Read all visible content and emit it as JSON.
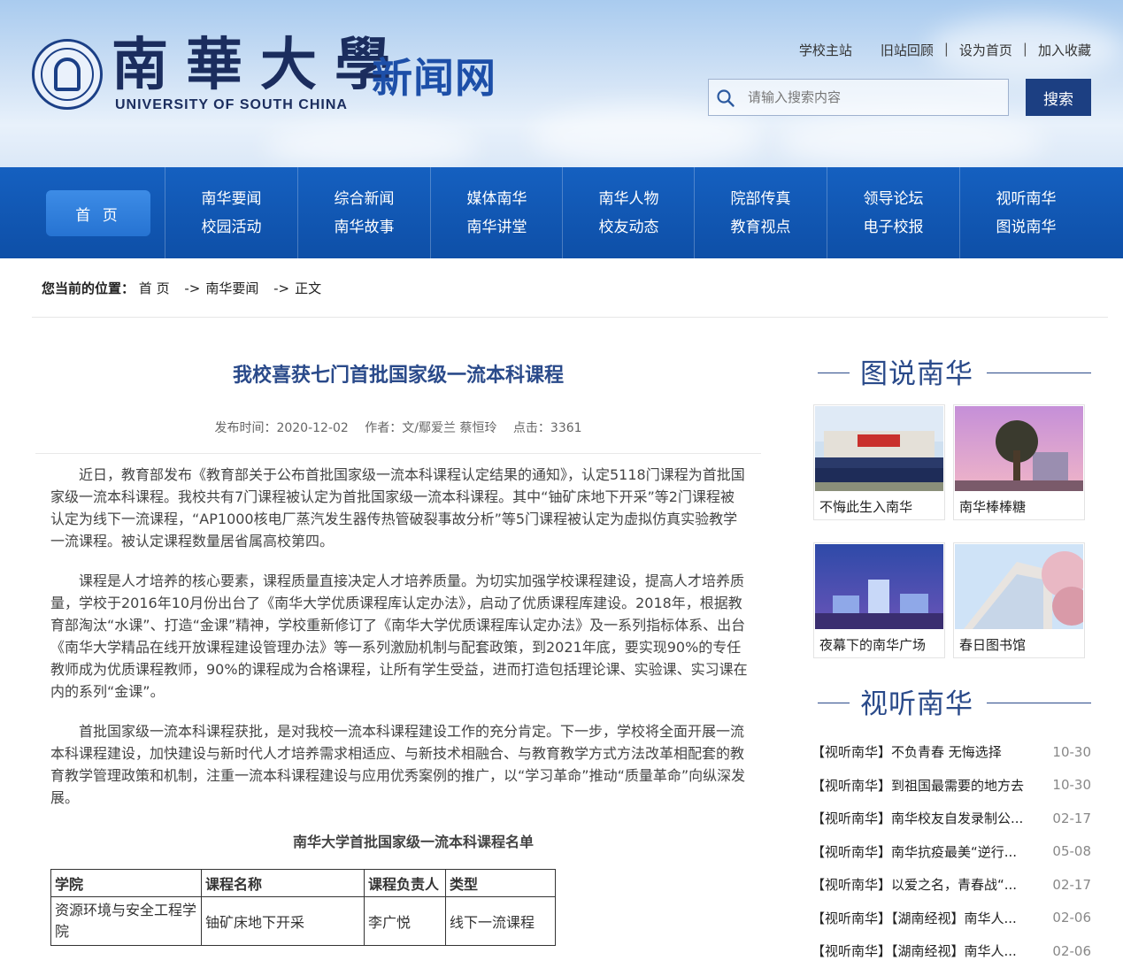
{
  "header": {
    "logo_cn": "南華大學",
    "logo_en": "UNIVERSITY OF SOUTH CHINA",
    "site_name": "新闻网",
    "top_links": [
      "学校主站",
      "旧站回顾",
      "设为首页",
      "加入收藏"
    ],
    "search_placeholder": "请输入搜索内容",
    "search_button": "搜索"
  },
  "nav": {
    "home": "首 页",
    "columns": [
      [
        "南华要闻",
        "校园活动"
      ],
      [
        "综合新闻",
        "南华故事"
      ],
      [
        "媒体南华",
        "南华讲堂"
      ],
      [
        "南华人物",
        "校友动态"
      ],
      [
        "院部传真",
        "教育视点"
      ],
      [
        "领导论坛",
        "电子校报"
      ],
      [
        "视听南华",
        "图说南华"
      ]
    ]
  },
  "breadcrumb": {
    "label": "您当前的位置：",
    "items": [
      "首 页",
      "南华要闻",
      "正文"
    ],
    "arrow": "->"
  },
  "article": {
    "title": "我校喜获七门首批国家级一流本科课程",
    "publish_time": "发布时间：2020-12-02",
    "author": "作者：文/鄢爱兰 蔡恒玲",
    "clicks": "点击：3361",
    "paragraphs": [
      "近日，教育部发布《教育部关于公布首批国家级一流本科课程认定结果的通知》，认定5118门课程为首批国家级一流本科课程。我校共有7门课程被认定为首批国家级一流本科课程。其中“铀矿床地下开采”等2门课程被认定为线下一流课程，“AP1000核电厂蒸汽发生器传热管破裂事故分析”等5门课程被认定为虚拟仿真实验教学一流课程。被认定课程数量居省属高校第四。",
      "课程是人才培养的核心要素，课程质量直接决定人才培养质量。为切实加强学校课程建设，提高人才培养质量，学校于2016年10月份出台了《南华大学优质课程库认定办法》，启动了优质课程库建设。2018年，根据教育部淘汰“水课”、打造“金课”精神，学校重新修订了《南华大学优质课程库认定办法》及一系列指标体系、出台《南华大学精品在线开放课程建设管理办法》等一系列激励机制与配套政策，到2021年底，要实现90%的专任教师成为优质课程教师，90%的课程成为合格课程，让所有学生受益，进而打造包括理论课、实验课、实习课在内的系列“金课”。",
      "首批国家级一流本科课程获批，是对我校一流本科课程建设工作的充分肯定。下一步，学校将全面开展一流本科课程建设，加快建设与新时代人才培养需求相适应、与新技术相融合、与教育教学方式方法改革相配套的教育教学管理政策和机制，注重一流本科课程建设与应用优秀案例的推广，以“学习革命”推动“质量革命”向纵深发展。"
    ],
    "table_caption": "南华大学首批国家级一流本科课程名单",
    "table_headers": [
      "学院",
      "课程名称",
      "课程负责人",
      "类型"
    ],
    "table_rows": [
      [
        "资源环境与安全工程学院",
        "铀矿床地下开采",
        "李广悦",
        "线下一流课程"
      ]
    ]
  },
  "sidebar": {
    "photo_title": "图说南华",
    "photos": [
      {
        "caption": "不悔此生入南华"
      },
      {
        "caption": "南华棒棒糖"
      },
      {
        "caption": "夜幕下的南华广场"
      },
      {
        "caption": "春日图书馆"
      }
    ],
    "video_title": "视听南华",
    "videos": [
      {
        "title": "【视听南华】不负青春 无悔选择",
        "date": "10-30"
      },
      {
        "title": "【视听南华】到祖国最需要的地方去",
        "date": "10-30"
      },
      {
        "title": "【视听南华】南华校友自发录制公...",
        "date": "02-17"
      },
      {
        "title": "【视听南华】南华抗疫最美“逆行...",
        "date": "05-08"
      },
      {
        "title": "【视听南华】以爱之名，青春战“...",
        "date": "02-17"
      },
      {
        "title": "【视听南华】【湖南经视】南华人...",
        "date": "02-06"
      },
      {
        "title": "【视听南华】【湖南经视】南华人...",
        "date": "02-06"
      }
    ]
  }
}
